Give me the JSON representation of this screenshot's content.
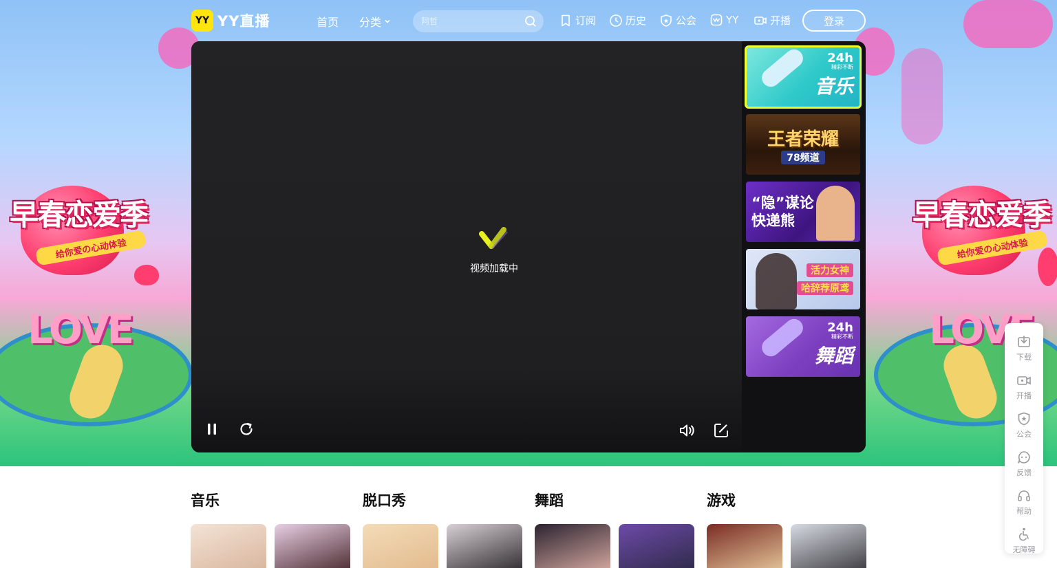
{
  "header": {
    "logo_badge": "YY",
    "logo_text": "YY直播",
    "nav": {
      "home": "首页",
      "category": "分类"
    },
    "search_placeholder": "阿哲",
    "items": {
      "subscribe": "订阅",
      "history": "历史",
      "guild": "公会",
      "yy": "YY",
      "broadcast": "开播"
    },
    "login": "登录"
  },
  "hero": {
    "campaign_title": "早春恋爱季",
    "campaign_subtitle": "给你爱の心动体验",
    "love_text": "LOVE"
  },
  "player": {
    "loading_text": "视频加载中",
    "channels": [
      {
        "title": "音乐",
        "badge": "24h",
        "badge_sub": "精彩不断",
        "active": true,
        "bg": "#2ec9c9"
      },
      {
        "title": "王者荣耀",
        "subtitle": "78频道",
        "active": false,
        "bg": "#3a2413"
      },
      {
        "title": "“隐”谋论 快递熊",
        "active": false,
        "bg": "#4a1d8e"
      },
      {
        "title": "活力女神",
        "subtitle": "哈辞荐原鸢",
        "active": false,
        "bg": "#c3d3f0"
      },
      {
        "title": "舞蹈",
        "badge": "24h",
        "badge_sub": "精彩不断",
        "active": false,
        "bg": "#7c3fc0"
      }
    ]
  },
  "sections": [
    {
      "title": "音乐"
    },
    {
      "title": "脱口秀"
    },
    {
      "title": "舞蹈"
    },
    {
      "title": "游戏"
    }
  ],
  "float_bar": {
    "download": "下载",
    "broadcast": "开播",
    "guild": "公会",
    "feedback": "反馈",
    "help": "帮助",
    "accessibility": "无障碍"
  },
  "colors": {
    "brand_yellow": "#ffe40e",
    "active_outline": "#f2ff2e",
    "player_bg": "#1f1f21"
  }
}
